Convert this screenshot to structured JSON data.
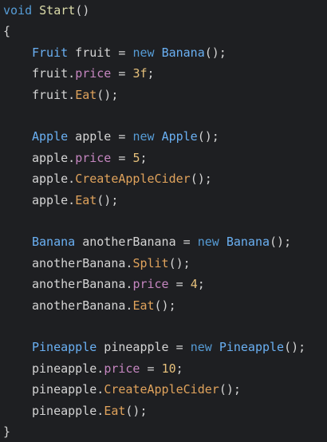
{
  "editor": {
    "lines": [
      [
        {
          "t": "void",
          "c": "kw"
        },
        {
          "t": " ",
          "c": "punc"
        },
        {
          "t": "Start",
          "c": "method"
        },
        {
          "t": "()",
          "c": "punc"
        }
      ],
      [
        {
          "t": "{",
          "c": "punc"
        }
      ],
      [
        {
          "t": "Fruit",
          "c": "type-blue"
        },
        {
          "t": " fruit ",
          "c": "id"
        },
        {
          "t": "=",
          "c": "op"
        },
        {
          "t": " ",
          "c": "punc"
        },
        {
          "t": "new",
          "c": "kw"
        },
        {
          "t": " ",
          "c": "punc"
        },
        {
          "t": "Banana",
          "c": "type-blue"
        },
        {
          "t": "();",
          "c": "punc"
        }
      ],
      [
        {
          "t": "fruit",
          "c": "id"
        },
        {
          "t": ".",
          "c": "punc"
        },
        {
          "t": "price",
          "c": "prop"
        },
        {
          "t": " = ",
          "c": "op"
        },
        {
          "t": "3f",
          "c": "num"
        },
        {
          "t": ";",
          "c": "punc"
        }
      ],
      [
        {
          "t": "fruit",
          "c": "id"
        },
        {
          "t": ".",
          "c": "punc"
        },
        {
          "t": "Eat",
          "c": "method-orange"
        },
        {
          "t": "();",
          "c": "punc"
        }
      ],
      [],
      [
        {
          "t": "Apple",
          "c": "type-blue"
        },
        {
          "t": " apple ",
          "c": "id"
        },
        {
          "t": "=",
          "c": "op"
        },
        {
          "t": " ",
          "c": "punc"
        },
        {
          "t": "new",
          "c": "kw"
        },
        {
          "t": " ",
          "c": "punc"
        },
        {
          "t": "Apple",
          "c": "type-blue"
        },
        {
          "t": "();",
          "c": "punc"
        }
      ],
      [
        {
          "t": "apple",
          "c": "id"
        },
        {
          "t": ".",
          "c": "punc"
        },
        {
          "t": "price",
          "c": "prop"
        },
        {
          "t": " = ",
          "c": "op"
        },
        {
          "t": "5",
          "c": "num"
        },
        {
          "t": ";",
          "c": "punc"
        }
      ],
      [
        {
          "t": "apple",
          "c": "id"
        },
        {
          "t": ".",
          "c": "punc"
        },
        {
          "t": "CreateAppleCider",
          "c": "method-orange"
        },
        {
          "t": "();",
          "c": "punc"
        }
      ],
      [
        {
          "t": "apple",
          "c": "id"
        },
        {
          "t": ".",
          "c": "punc"
        },
        {
          "t": "Eat",
          "c": "method-orange"
        },
        {
          "t": "();",
          "c": "punc"
        }
      ],
      [],
      [
        {
          "t": "Banana",
          "c": "type-blue"
        },
        {
          "t": " anotherBanana ",
          "c": "id"
        },
        {
          "t": "=",
          "c": "op"
        },
        {
          "t": " ",
          "c": "punc"
        },
        {
          "t": "new",
          "c": "kw"
        },
        {
          "t": " ",
          "c": "punc"
        },
        {
          "t": "Banana",
          "c": "type-blue"
        },
        {
          "t": "();",
          "c": "punc"
        }
      ],
      [
        {
          "t": "anotherBanana",
          "c": "id"
        },
        {
          "t": ".",
          "c": "punc"
        },
        {
          "t": "Split",
          "c": "method-orange"
        },
        {
          "t": "();",
          "c": "punc"
        }
      ],
      [
        {
          "t": "anotherBanana",
          "c": "id"
        },
        {
          "t": ".",
          "c": "punc"
        },
        {
          "t": "price",
          "c": "prop"
        },
        {
          "t": " = ",
          "c": "op"
        },
        {
          "t": "4",
          "c": "num"
        },
        {
          "t": ";",
          "c": "punc"
        }
      ],
      [
        {
          "t": "anotherBanana",
          "c": "id"
        },
        {
          "t": ".",
          "c": "punc"
        },
        {
          "t": "Eat",
          "c": "method-orange"
        },
        {
          "t": "();",
          "c": "punc"
        }
      ],
      [],
      [
        {
          "t": "Pineapple",
          "c": "type-blue"
        },
        {
          "t": " pineapple ",
          "c": "id"
        },
        {
          "t": "=",
          "c": "op"
        },
        {
          "t": " ",
          "c": "punc"
        },
        {
          "t": "new",
          "c": "kw"
        },
        {
          "t": " ",
          "c": "punc"
        },
        {
          "t": "Pineapple",
          "c": "type-blue"
        },
        {
          "t": "();",
          "c": "punc"
        }
      ],
      [
        {
          "t": "pineapple",
          "c": "id"
        },
        {
          "t": ".",
          "c": "punc"
        },
        {
          "t": "price",
          "c": "prop"
        },
        {
          "t": " = ",
          "c": "op"
        },
        {
          "t": "10",
          "c": "num"
        },
        {
          "t": ";",
          "c": "punc"
        }
      ],
      [
        {
          "t": "pineapple",
          "c": "id"
        },
        {
          "t": ".",
          "c": "punc"
        },
        {
          "t": "CreateAppleCider",
          "c": "method-orange"
        },
        {
          "t": "();",
          "c": "punc"
        }
      ],
      [
        {
          "t": "pineapple",
          "c": "id"
        },
        {
          "t": ".",
          "c": "punc"
        },
        {
          "t": "Eat",
          "c": "method-orange"
        },
        {
          "t": "();",
          "c": "punc"
        }
      ],
      [
        {
          "t": "}",
          "c": "punc"
        }
      ]
    ]
  },
  "colors": {
    "background": "#1e1f22",
    "keyword": "#569cd6",
    "type": "#6ab0f3",
    "method": "#dcdcaa",
    "member_call": "#e0a35c",
    "property": "#c586c0",
    "number": "#e6c07b",
    "text": "#d4d4d4"
  }
}
